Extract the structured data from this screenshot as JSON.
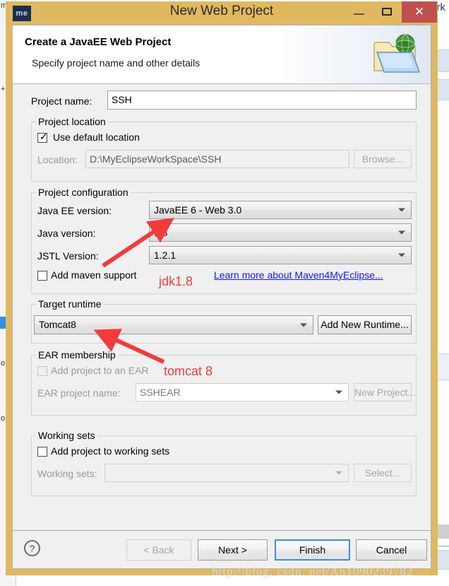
{
  "window": {
    "title": "New Web Project",
    "app_icon_label": "me",
    "minimize_label": "–",
    "maximize_label": "□",
    "close_label": "✕",
    "close_color": "#c0504d",
    "frame_color": "#e0b860"
  },
  "header": {
    "title": "Create a JavaEE Web Project",
    "subtitle": "Specify project name and other details",
    "icon": "web-project-folder-globe-icon"
  },
  "project_name": {
    "label": "Project name:",
    "value": "SSH",
    "placeholder": ""
  },
  "project_location": {
    "group_title": "Project location",
    "use_default_label": "Use default location",
    "use_default_checked": true,
    "location_label": "Location:",
    "location_value": "D:\\MyEclipseWorkSpace\\SSH",
    "browse_label": "Browse..."
  },
  "project_configuration": {
    "group_title": "Project configuration",
    "javaee_label": "Java EE version:",
    "javaee_value": "JavaEE 6 - Web 3.0",
    "java_label": "Java version:",
    "java_value": "1.8",
    "jstl_label": "JSTL Version:",
    "jstl_value": "1.2.1",
    "maven_label": "Add maven support",
    "maven_checked": false,
    "maven_link": "Learn more about Maven4MyEclipse..."
  },
  "target_runtime": {
    "group_title": "Target runtime",
    "value": "Tomcat8",
    "add_runtime_label": "Add New Runtime..."
  },
  "ear_membership": {
    "group_title": "EAR membership",
    "add_to_ear_label": "Add project to an EAR",
    "add_to_ear_checked": false,
    "ear_project_label": "EAR project name:",
    "ear_project_value": "SSHEAR",
    "new_project_label": "New Project..."
  },
  "working_sets": {
    "group_title": "Working sets",
    "add_to_working_sets_label": "Add project to working sets",
    "add_to_working_sets_checked": false,
    "working_sets_label": "Working sets:",
    "working_sets_value": "",
    "select_label": "Select..."
  },
  "footer": {
    "help_label": "?",
    "back_label": "< Back",
    "next_label": "Next >",
    "finish_label": "Finish",
    "cancel_label": "Cancel"
  },
  "annotations": {
    "color": "#f23b3b",
    "jdk_note": "jdk1.8",
    "tomcat_note": "tomcat 8"
  },
  "watermark": {
    "text": "http://blog. csdn. net/An1090239782"
  },
  "background": {
    "right_title": "ork",
    "left_chars": [
      "m",
      "+",
      "o",
      "o"
    ]
  }
}
